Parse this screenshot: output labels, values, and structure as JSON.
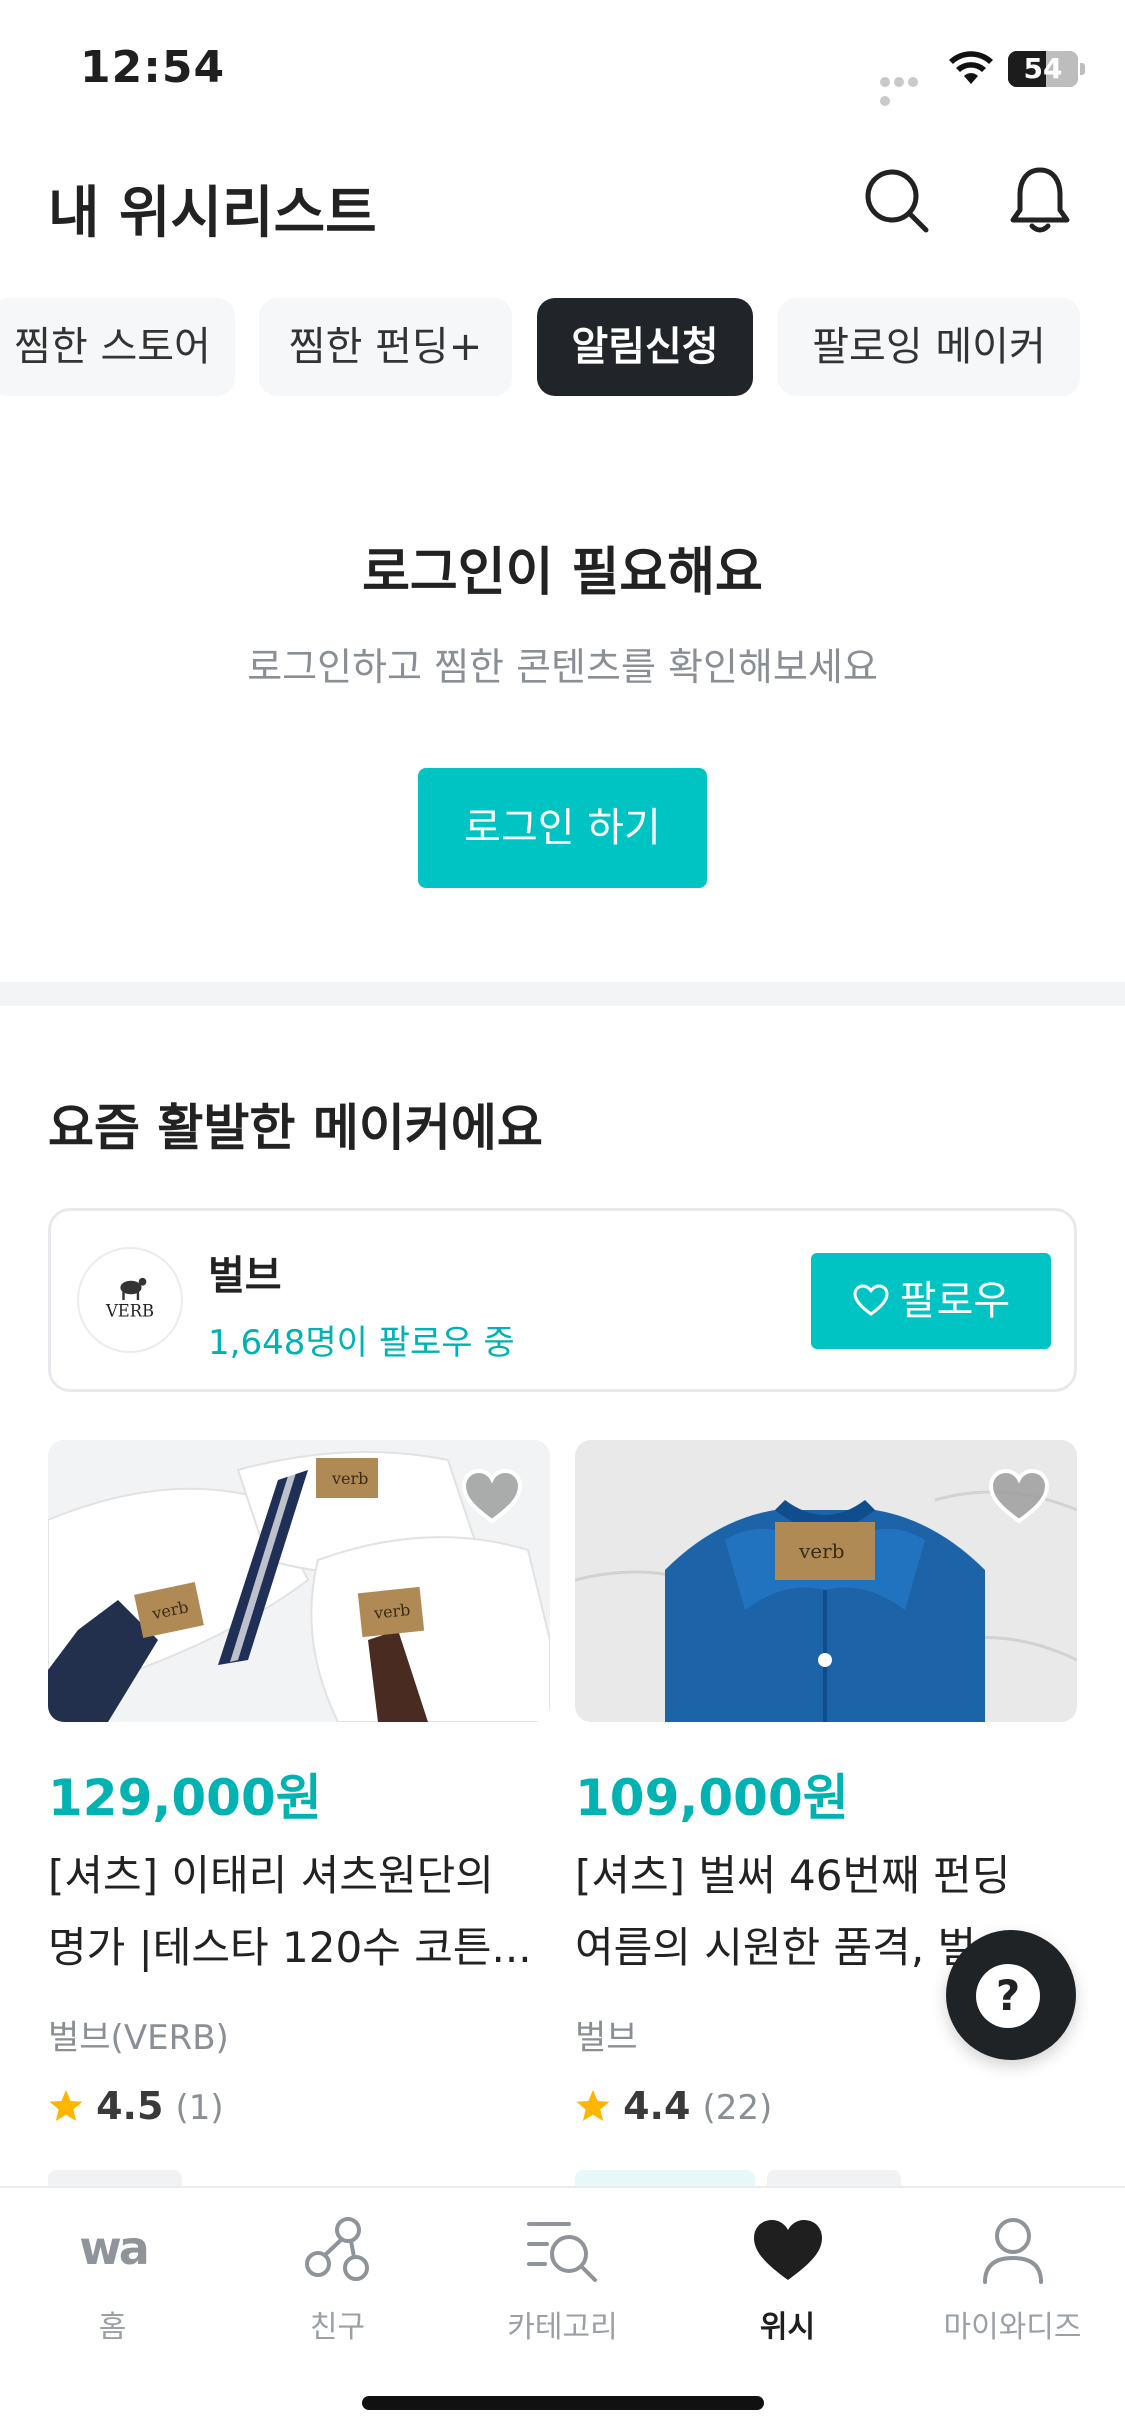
{
  "status_bar": {
    "time": "12:54",
    "battery": "54",
    "battery_level_percent": 54
  },
  "header": {
    "title": "내 위시리스트"
  },
  "chips": [
    {
      "label": "찜한 스토어",
      "active": false
    },
    {
      "label": "찜한 펀딩+",
      "active": false
    },
    {
      "label": "알림신청",
      "active": true
    },
    {
      "label": "팔로잉 메이커",
      "active": false
    }
  ],
  "login": {
    "title": "로그인이 필요해요",
    "subtitle": "로그인하고 찜한 콘텐츠를 확인해보세요",
    "button": "로그인 하기"
  },
  "section": {
    "title": "요즘 활발한 메이커에요"
  },
  "maker": {
    "name": "벌브",
    "followers": "1,648명이 팔로우 중",
    "follow_button": "팔로우",
    "logo_text": "VERB"
  },
  "products": [
    {
      "price": "129,000원",
      "title_line1": "[셔츠] 이태리 셔츠원단의",
      "title_line2": "명가 |테스타 120수 코튼...",
      "maker": "벌브(VERB)",
      "rating": "4.5",
      "reviews": "(1)",
      "label_text": "verb"
    },
    {
      "price": "109,000원",
      "title_line1": "[셔츠] 벌써 46번째 펀딩",
      "title_line2": "여름의 시원한 품격, 벌...",
      "maker": "벌브",
      "rating": "4.4",
      "reviews": "(22)",
      "label_text": "verb"
    }
  ],
  "help": {
    "label": "?"
  },
  "tabs": [
    {
      "label": "홈",
      "icon": "wadiz-logo-icon",
      "active": false
    },
    {
      "label": "친구",
      "icon": "friends-network-icon",
      "active": false
    },
    {
      "label": "카테고리",
      "icon": "category-search-icon",
      "active": false
    },
    {
      "label": "위시",
      "icon": "heart-icon",
      "active": true
    },
    {
      "label": "마이와디즈",
      "icon": "person-icon",
      "active": false
    }
  ],
  "colors": {
    "accent": "#00c4c4",
    "price": "#00b2b2",
    "dark_chip": "#212529"
  }
}
